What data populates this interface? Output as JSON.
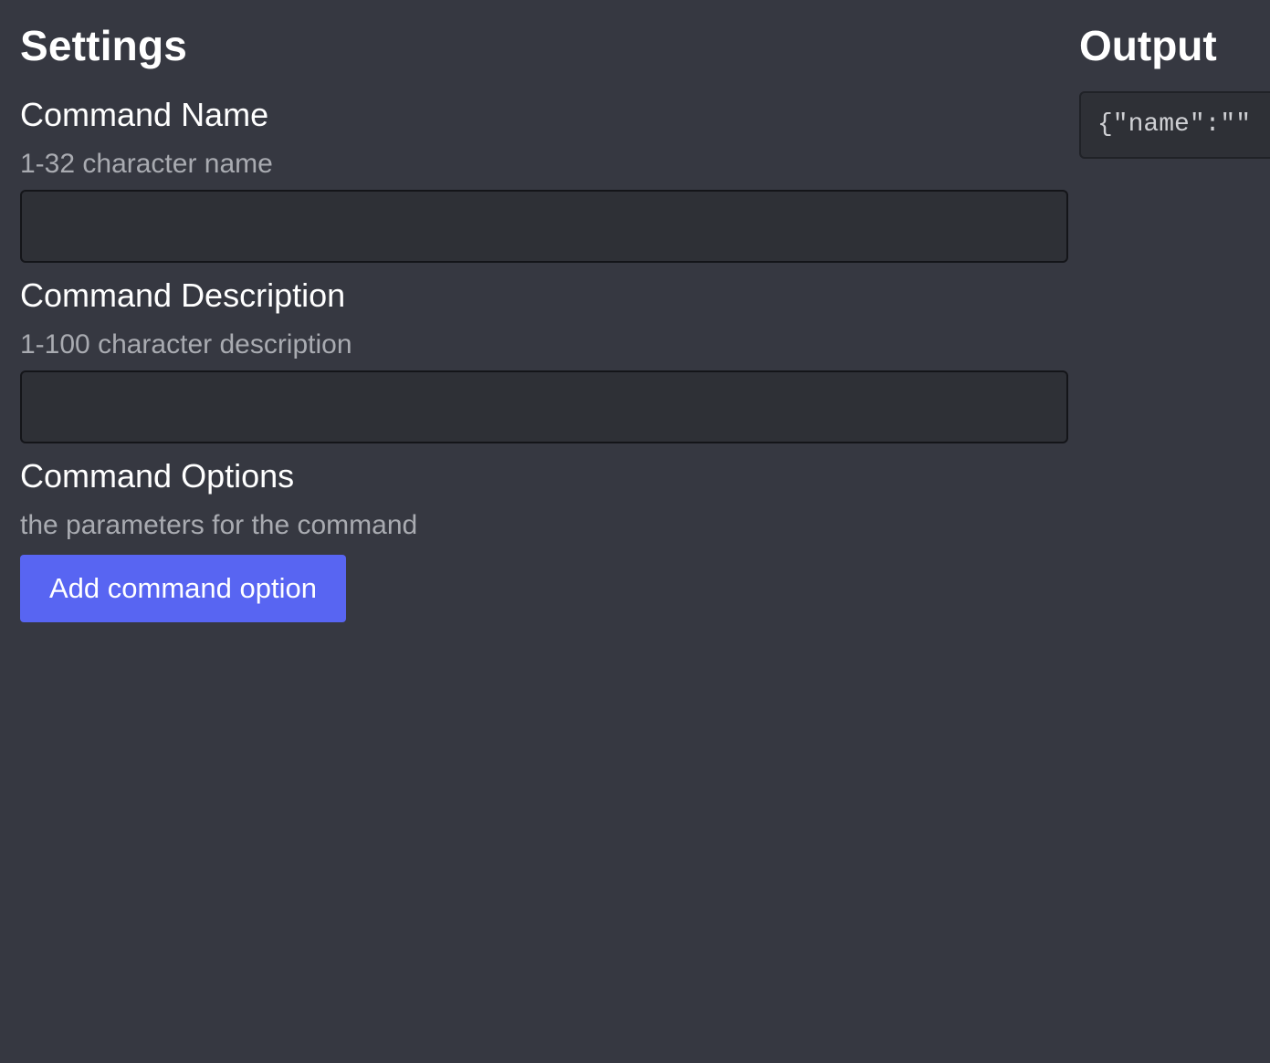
{
  "settings": {
    "title": "Settings",
    "name_field": {
      "label": "Command Name",
      "description": "1-32 character name",
      "value": ""
    },
    "description_field": {
      "label": "Command Description",
      "description": "1-100 character description",
      "value": ""
    },
    "options_field": {
      "label": "Command Options",
      "description": "the parameters for the command",
      "add_button_label": "Add command option"
    }
  },
  "output": {
    "title": "Output",
    "json_text": "{\"name\":\"\""
  },
  "colors": {
    "background": "#363841",
    "input_background": "#2e3036",
    "accent": "#5865f2",
    "muted_text": "#a9abb1"
  }
}
